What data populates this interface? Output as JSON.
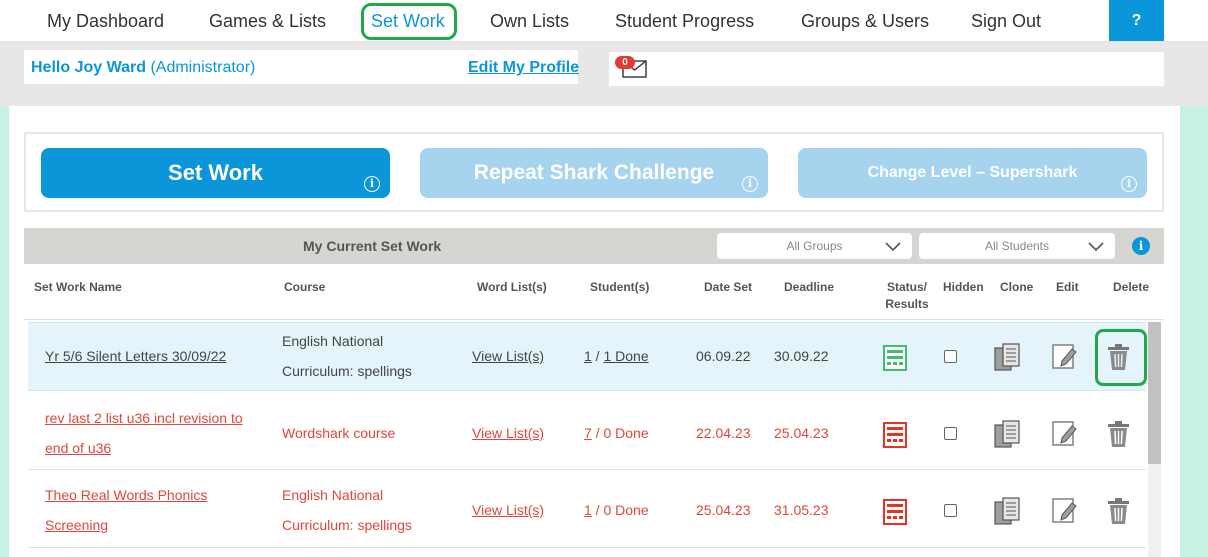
{
  "nav": {
    "items": [
      {
        "label": "My Dashboard"
      },
      {
        "label": "Games & Lists"
      },
      {
        "label": "Set Work"
      },
      {
        "label": "Own Lists"
      },
      {
        "label": "Student Progress"
      },
      {
        "label": "Groups & Users"
      },
      {
        "label": "Sign Out"
      }
    ],
    "help_label": "?"
  },
  "header": {
    "hello_name": "Hello Joy Ward",
    "role": "(Administrator)",
    "edit_profile": "Edit My Profile",
    "message_count": "0"
  },
  "actions": {
    "set_work": "Set Work",
    "repeat": "Repeat Shark Challenge",
    "change_level": "Change Level – Supershark",
    "info_glyph": "i"
  },
  "table": {
    "title": "My Current Set Work",
    "filter_groups": "All Groups",
    "filter_students": "All Students",
    "columns": {
      "name": "Set Work Name",
      "course": "Course",
      "wordlist": "Word List(s)",
      "students": "Student(s)",
      "date_set": "Date Set",
      "deadline": "Deadline",
      "status_1": "Status/",
      "status_2": "Results",
      "hidden": "Hidden",
      "clone": "Clone",
      "edit": "Edit",
      "delete": "Delete"
    },
    "rows": [
      {
        "name_1": "Yr 5/6 Silent Letters 30/09/22",
        "course_1": "English National",
        "course_2": "Curriculum: spellings",
        "wordlist": "View List(s)",
        "students_n": "1",
        "students_sep": " / ",
        "done": "1 Done",
        "date_set": "06.09.22",
        "deadline": "30.09.22",
        "status_color": "#3fbf6e"
      },
      {
        "name_1": "rev last 2 list u36 incl revision to",
        "name_2": "end of u36",
        "course_1": "Wordshark course",
        "wordlist": "View List(s)",
        "students_n": "7",
        "students_sep": " / ",
        "done": "0 Done",
        "date_set": "22.04.23",
        "deadline": "25.04.23",
        "status_color": "#e53320"
      },
      {
        "name_1": "Theo Real Words Phonics",
        "name_2": "Screening",
        "course_1": "English National",
        "course_2": "Curriculum: spellings",
        "wordlist": "View List(s)",
        "students_n": "1",
        "students_sep": " / ",
        "done": "0 Done",
        "date_set": "25.04.23",
        "deadline": "31.05.23",
        "status_color": "#e53320"
      }
    ]
  }
}
